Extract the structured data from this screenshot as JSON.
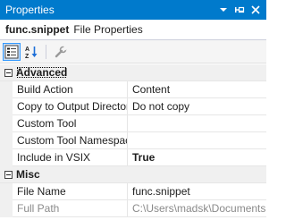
{
  "window": {
    "title": "Properties"
  },
  "object": {
    "name": "func.snippet",
    "type": "File Properties"
  },
  "categories": [
    {
      "label": "Advanced",
      "properties": [
        {
          "name": "Build Action",
          "value": "Content",
          "bold": false
        },
        {
          "name": "Copy to Output Directory",
          "value": "Do not copy",
          "bold": false
        },
        {
          "name": "Custom Tool",
          "value": "",
          "bold": false
        },
        {
          "name": "Custom Tool Namespace",
          "value": "",
          "bold": false
        },
        {
          "name": "Include in VSIX",
          "value": "True",
          "bold": true
        }
      ]
    },
    {
      "label": "Misc",
      "properties": [
        {
          "name": "File Name",
          "value": "func.snippet",
          "bold": false
        },
        {
          "name": "Full Path",
          "value": "C:\\Users\\madsk\\Documents",
          "bold": false,
          "disabled": true
        }
      ]
    }
  ],
  "icons": {
    "title_dropdown": "chevron-down-icon",
    "title_pin": "pin-icon",
    "title_close": "close-icon",
    "categorized": "categorized-icon",
    "alphabetical": "alphabetical-sort-icon",
    "property_pages": "wrench-icon",
    "collapse": "collapse-minus-icon"
  },
  "colors": {
    "titlebar": "#007acc",
    "selection": "#3399ff"
  }
}
